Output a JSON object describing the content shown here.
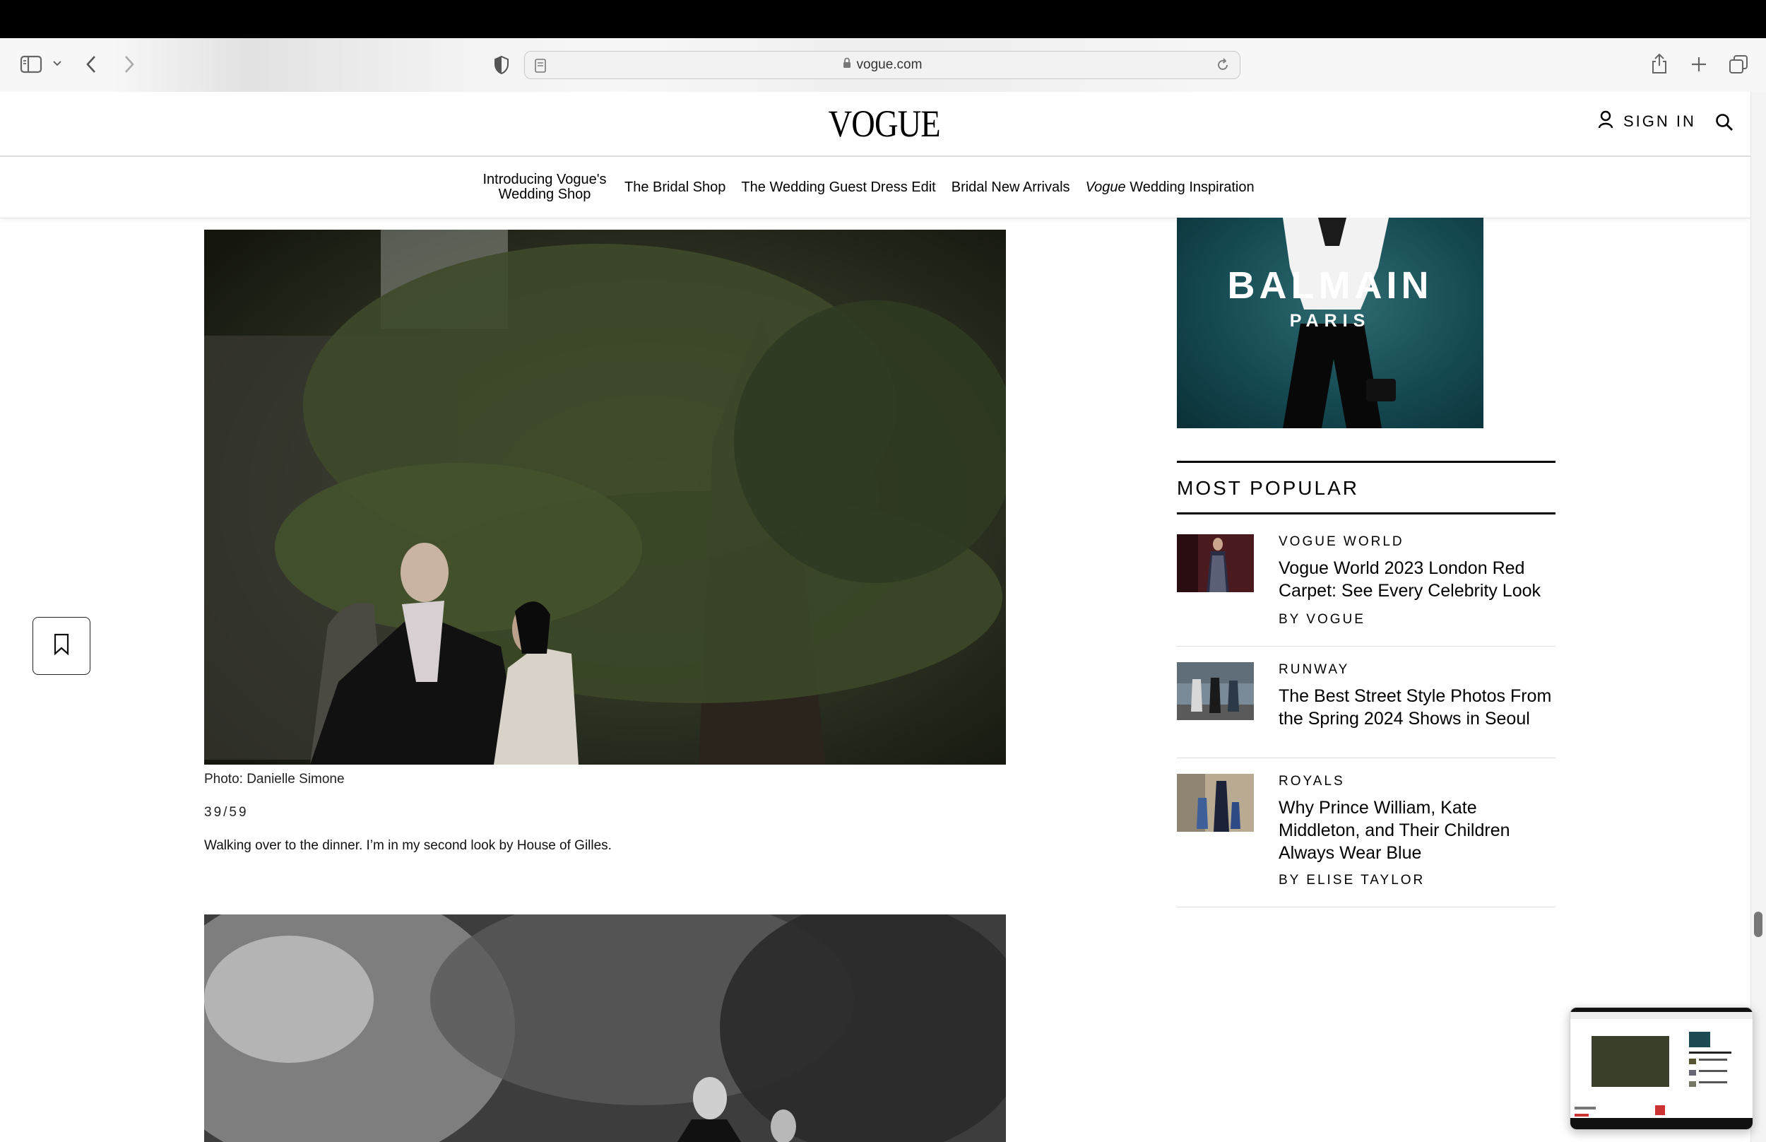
{
  "browser": {
    "url": "vogue.com"
  },
  "header": {
    "logo": "VOGUE",
    "sign_in": "SIGN IN"
  },
  "subnav": {
    "items": [
      "Introducing Vogue's Wedding Shop",
      "The Bridal Shop",
      "The Wedding Guest Dress Edit",
      "Bridal New Arrivals"
    ],
    "last_italic": "Vogue",
    "last_rest": " Wedding Inspiration"
  },
  "article": {
    "photo_credit": "Photo: Danielle Simone",
    "counter": "39/59",
    "caption": "Walking over to the dinner. I’m in my second look by House of Gilles."
  },
  "ad": {
    "brand": "BALMAIN",
    "city": "PARIS"
  },
  "most_popular": {
    "heading": "MOST POPULAR",
    "items": [
      {
        "category": "VOGUE WORLD",
        "title": "Vogue World 2023 London Red Carpet: See Every Celebrity Look",
        "byline": "BY VOGUE"
      },
      {
        "category": "RUNWAY",
        "title": "The Best Street Style Photos From the Spring 2024 Shows in Seoul",
        "byline": ""
      },
      {
        "category": "ROYALS",
        "title": "Why Prince William, Kate Middleton, and Their Children Always Wear Blue",
        "byline": "BY ELISE TAYLOR"
      }
    ]
  },
  "colors": {
    "ad_background": "#154a52",
    "text": "#000000"
  }
}
